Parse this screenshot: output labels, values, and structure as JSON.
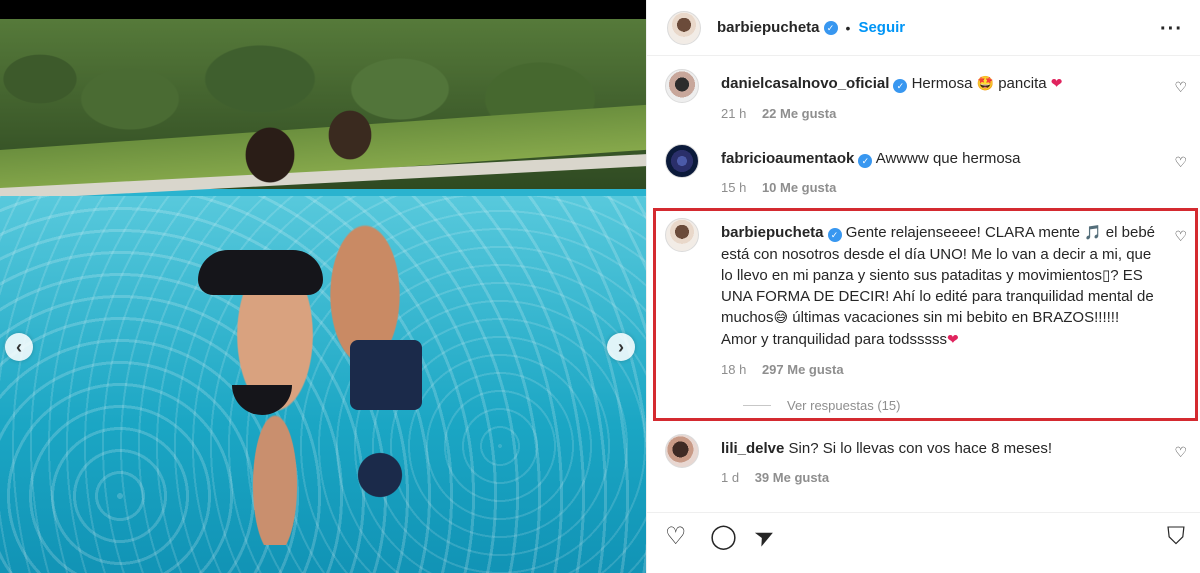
{
  "post_header": {
    "username": "barbiepucheta",
    "verified_mark": "✓",
    "separator": "•",
    "follow_label": "Seguir",
    "more_icon": "more-options-icon"
  },
  "comments": [
    {
      "username": "danielcasalnovo_oficial",
      "text_before": "Hermosa",
      "emoji1": "🤩",
      "text_middle": "pancita",
      "emoji2": "❤",
      "time": "21 h",
      "likes": "22 Me gusta"
    },
    {
      "username": "fabricioaumentaok",
      "text": "Awwww que hermosa",
      "time": "15 h",
      "likes": "10 Me gusta"
    },
    {
      "username": "barbiepucheta",
      "text_a": "Gente relajenseeee! CLARA mente",
      "note_emoji": "🎵",
      "text_b": "el bebé está con nosotros desde el día UNO! Me lo van a decir a mi, que lo llevo en mi panza y siento sus pataditas y movimientos",
      "missing_glyph": "▯",
      "text_c": "? ES UNA FORMA DE DECIR! Ahí lo edité para tranquilidad mental de muchos",
      "laugh_emoji": "😅",
      "text_d": " últimas vacaciones sin mi bebito en BRAZOS!!!!!! Amor y tranquilidad para todsssss",
      "heart_emoji": "❤",
      "time": "18 h",
      "likes": "297 Me gusta",
      "replies": "Ver respuestas (15)"
    },
    {
      "username": "lili_delve",
      "text": "Sin? Si lo llevas con vos hace 8 meses!",
      "time": "1 d",
      "likes": "39 Me gusta"
    }
  ],
  "photo_nav": {
    "prev": "‹",
    "next": "›"
  },
  "actions": {
    "like_icon": "♡",
    "comment_icon": "◯",
    "share_icon": "➤",
    "save_icon": "⛉"
  },
  "colors": {
    "link": "#0095f6",
    "verified": "#3897f0",
    "highlight": "#d42a30"
  }
}
